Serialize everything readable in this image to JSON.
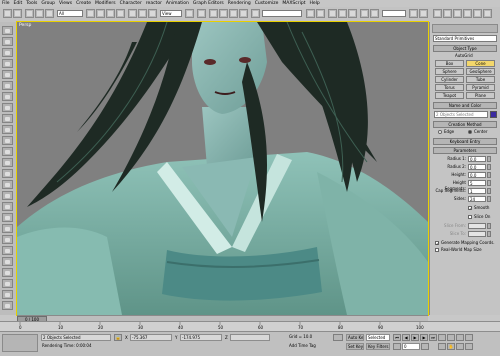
{
  "menu": [
    "File",
    "Edit",
    "Tools",
    "Group",
    "Views",
    "Create",
    "Modifiers",
    "Character",
    "reactor",
    "Animation",
    "Graph Editors",
    "Rendering",
    "Customize",
    "MAXScript",
    "Help"
  ],
  "toolbar": {
    "filter_value": "All",
    "coord_value": "View",
    "selection_set_value": ""
  },
  "viewport": {
    "label": "Persp"
  },
  "command_panel": {
    "category_value": "Standard Primitives",
    "object_type_title": "Object Type",
    "autogrid_label": "AutoGrid",
    "primitives": [
      "Box",
      "Cone",
      "Sphere",
      "GeoSphere",
      "Cylinder",
      "Tube",
      "Torus",
      "Pyramid",
      "Teapot",
      "Plane"
    ],
    "name_color_title": "Name and Color",
    "name_value": "2 Objects Selected",
    "creation_method_title": "Creation Method",
    "creation_options": [
      "Edge",
      "Center"
    ],
    "keyboard_entry_title": "Keyboard Entry",
    "parameters_title": "Parameters",
    "params": [
      {
        "label": "Radius 1:",
        "value": "0.0"
      },
      {
        "label": "Radius 2:",
        "value": "0.0"
      },
      {
        "label": "Height:",
        "value": "0.0"
      },
      {
        "label": "Height Segments:",
        "value": "5"
      },
      {
        "label": "Cap Segments:",
        "value": "1"
      },
      {
        "label": "Sides:",
        "value": "24"
      }
    ],
    "smooth_label": "Smooth",
    "slice_on_label": "Slice On",
    "slice_from_label": "Slice From:",
    "slice_to_label": "Slice To:",
    "gen_mapping_label": "Generate Mapping Coords.",
    "real_world_label": "Real-World Map Size"
  },
  "timeline": {
    "frame_readout": "0 / 100",
    "ticks": [
      "0",
      "10",
      "20",
      "30",
      "40",
      "50",
      "60",
      "70",
      "80",
      "90",
      "100"
    ]
  },
  "status": {
    "selection_text": "2 Objects Selected",
    "render_time_text": "Rendering Time: 0:00:04",
    "x_value": "-75.367",
    "y_value": "-174.975",
    "grid_text": "Grid = 10.0",
    "add_time_tag": "Add Time Tag",
    "auto_key_label": "Auto Key",
    "set_key_label": "Set Key",
    "key_mode_value": "Selected",
    "key_filters_label": "Key Filters...",
    "frame_value": "0"
  },
  "colors": {
    "viewport_bg": "#808080",
    "active_button": "#f3d76b",
    "object_color_swatch": "#3a2aa0",
    "active_viewport_border": "#e8d000"
  }
}
